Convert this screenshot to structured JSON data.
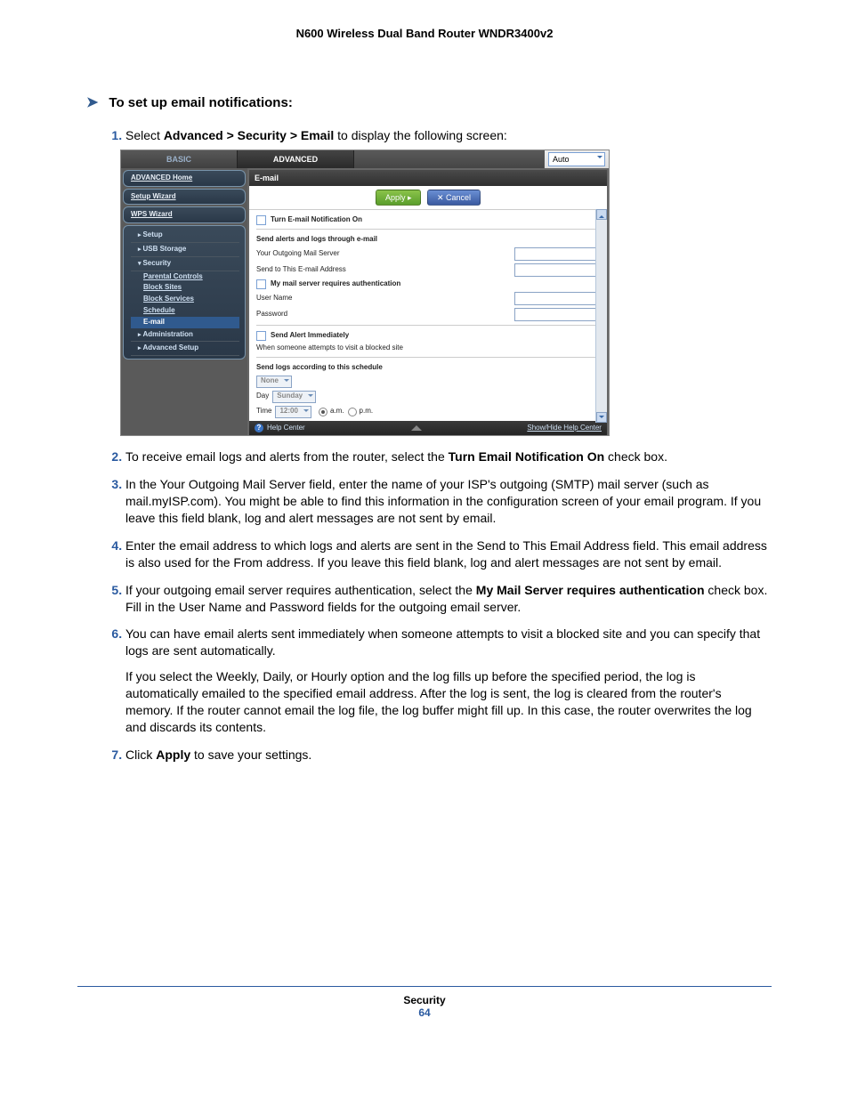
{
  "running_head": "N600 Wireless Dual Band Router WNDR3400v2",
  "heading": "To set up email notifications:",
  "steps": {
    "s1_pre": "Select ",
    "s1_b1": "Advanced > Security > Email",
    "s1_post": " to display the following screen:",
    "s2_pre": "To receive email logs and alerts from the router, select the ",
    "s2_b1": "Turn Email Notification On",
    "s2_post": " check box.",
    "s3": "In the Your Outgoing Mail Server field, enter the name of your ISP's outgoing (SMTP) mail server (such as mail.myISP.com). You might be able to find this information in the configuration screen of your email program. If you leave this field blank, log and alert messages are not sent by email.",
    "s4": "Enter the email address to which logs and alerts are sent in the Send to This Email Address field. This email address is also used for the From address. If you leave this field blank, log and alert messages are not sent by email.",
    "s5_pre": "If your outgoing email server requires authentication, select the ",
    "s5_b1": "My Mail Server requires authentication",
    "s5_post": " check box. Fill in the User Name and Password fields for the outgoing email server.",
    "s6a": " You can have email alerts sent immediately when someone attempts to visit a blocked site and you can specify that logs are sent automatically.",
    "s6b": "If you select the Weekly, Daily, or Hourly option and the log fills up before the specified period, the log is automatically emailed to the specified email address. After the log is sent, the log is cleared from the router's memory. If the router cannot email the log file, the log buffer might fill up. In this case, the router overwrites the log and discards its contents.",
    "s7_pre": "Click ",
    "s7_b1": "Apply",
    "s7_post": " to save your settings."
  },
  "ui": {
    "tabs": {
      "basic": "BASIC",
      "advanced": "ADVANCED",
      "auto": "Auto"
    },
    "sidebar": {
      "adv_home": "ADVANCED Home",
      "setup_wiz": "Setup Wizard",
      "wps_wiz": "WPS Wizard",
      "setup": "Setup",
      "usb": "USB Storage",
      "security": "Security",
      "parental": "Parental Controls",
      "block_sites": "Block Sites",
      "block_services": "Block Services",
      "schedule": "Schedule",
      "email": "E-mail",
      "administration": "Administration",
      "adv_setup": "Advanced Setup"
    },
    "panel": {
      "title": "E-mail",
      "apply": "Apply ▸",
      "cancel": "✕ Cancel",
      "turn_on": "Turn E-mail Notification On",
      "section1": "Send alerts and logs through e-mail",
      "outgoing": "Your Outgoing Mail Server",
      "sendto": "Send to This E-mail Address",
      "auth": "My mail server requires authentication",
      "username": "User Name",
      "password": "Password",
      "send_alert": "Send Alert Immediately",
      "when_blocked": "When someone attempts to visit a blocked site",
      "schedule_label": "Send logs according to this schedule",
      "schedule_value": "None",
      "day_label": "Day",
      "day_value": "Sunday",
      "time_label": "Time",
      "time_value": "12:00",
      "am": "a.m.",
      "pm": "p.m.",
      "help_center": "Help Center",
      "show_hide": "Show/Hide Help Center"
    }
  },
  "footer": {
    "section": "Security",
    "page": "64"
  }
}
